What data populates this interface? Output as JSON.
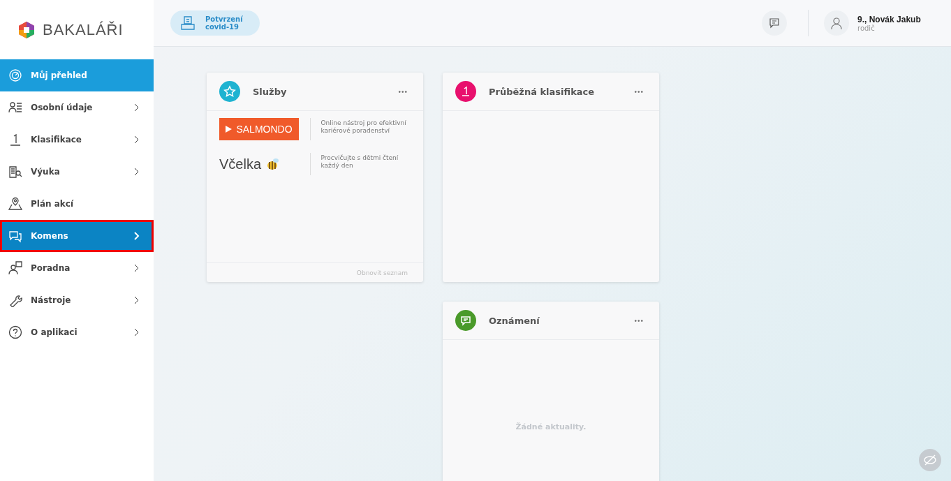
{
  "brand": {
    "name": "BAKALÁŘI"
  },
  "header": {
    "covid_button": {
      "line1": "Potvrzení",
      "line2": "covid-19"
    },
    "user": {
      "name": "9., Novák Jakub",
      "role": "rodič"
    }
  },
  "sidebar": {
    "items": [
      {
        "label": "Můj přehled",
        "selected": true,
        "hovered": false,
        "outlined": false,
        "has_submenu": false
      },
      {
        "label": "Osobní údaje",
        "selected": false,
        "hovered": false,
        "outlined": false,
        "has_submenu": true
      },
      {
        "label": "Klasifikace",
        "selected": false,
        "hovered": false,
        "outlined": false,
        "has_submenu": true
      },
      {
        "label": "Výuka",
        "selected": false,
        "hovered": false,
        "outlined": false,
        "has_submenu": true
      },
      {
        "label": "Plán akcí",
        "selected": false,
        "hovered": false,
        "outlined": false,
        "has_submenu": false
      },
      {
        "label": "Komens",
        "selected": false,
        "hovered": true,
        "outlined": true,
        "has_submenu": true
      },
      {
        "label": "Poradna",
        "selected": false,
        "hovered": false,
        "outlined": false,
        "has_submenu": true
      },
      {
        "label": "Nástroje",
        "selected": false,
        "hovered": false,
        "outlined": false,
        "has_submenu": true
      },
      {
        "label": "O aplikaci",
        "selected": false,
        "hovered": false,
        "outlined": false,
        "has_submenu": true
      }
    ]
  },
  "widgets": [
    {
      "kind": "services",
      "title": "Služby",
      "color": "#1fb3d1",
      "menu": "•••",
      "services": [
        {
          "logo": "SALMONDO",
          "kind": "salmondo",
          "description": "Online nástroj pro efektivní kariérové poradenství"
        },
        {
          "logo": "Včelka",
          "kind": "vcelka",
          "description": "Procvičujte s dětmi čtení každý den"
        }
      ],
      "footer": "Obnovit seznam"
    },
    {
      "kind": "empty",
      "title": "Průběžná klasifikace",
      "color": "#e8106d",
      "menu": "•••"
    },
    {
      "kind": "notice",
      "title": "Oznámení",
      "color": "#4a9a2a",
      "menu": "•••",
      "message": "Žádné aktuality."
    }
  ]
}
